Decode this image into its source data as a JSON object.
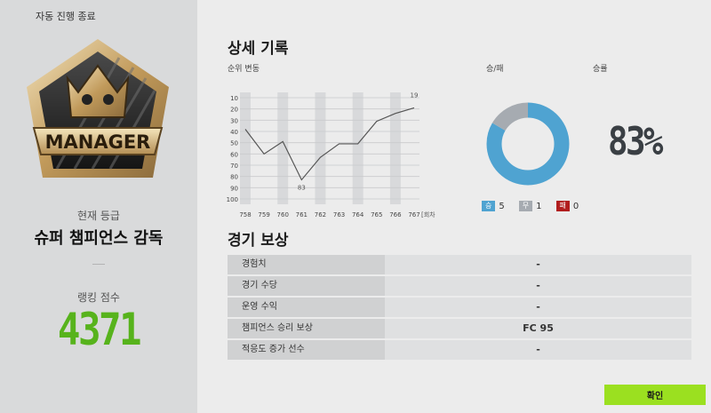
{
  "left": {
    "title": "자동 진행 종료",
    "badge_text": "MANAGER",
    "grade_label": "현재 등급",
    "grade_name": "슈퍼 챔피언스 감독",
    "rank_label": "랭킹 점수",
    "rank_score": "4371"
  },
  "detail": {
    "title": "상세 기록",
    "rank_change_label": "순위 변동",
    "wl_label": "승/패",
    "win_rate_label": "승률",
    "win_rate": "83%",
    "legend": [
      {
        "label": "승",
        "value": "5"
      },
      {
        "label": "무",
        "value": "1"
      },
      {
        "label": "패",
        "value": "0"
      }
    ]
  },
  "chart_data": {
    "type": "line",
    "x": [
      "758",
      "759",
      "760",
      "761",
      "762",
      "763",
      "764",
      "765",
      "766",
      "767"
    ],
    "x_unit": "[회차]",
    "values": [
      38,
      60,
      49,
      83,
      63,
      51,
      51,
      31,
      24,
      19
    ],
    "annotations": [
      "83",
      "19"
    ],
    "yticks": [
      10,
      20,
      30,
      40,
      50,
      60,
      70,
      80,
      90,
      100
    ],
    "ylim": [
      10,
      100
    ],
    "y_inverted": true
  },
  "record": {
    "win": 5,
    "draw": 1,
    "loss": 0
  },
  "colors": {
    "win": "#4fa3d1",
    "draw": "#a6abb1",
    "loss": "#b11d1d",
    "score": "#57b31c",
    "confirm": "#9be020"
  },
  "rewards": {
    "title": "경기 보상",
    "rows": [
      {
        "label": "경험치",
        "value": "-"
      },
      {
        "label": "경기 수당",
        "value": "-"
      },
      {
        "label": "운영 수익",
        "value": "-"
      },
      {
        "label": "챔피언스 승리 보상",
        "value": "FC 95"
      },
      {
        "label": "적응도 증가 선수",
        "value": "-"
      }
    ]
  },
  "confirm_label": "확인"
}
